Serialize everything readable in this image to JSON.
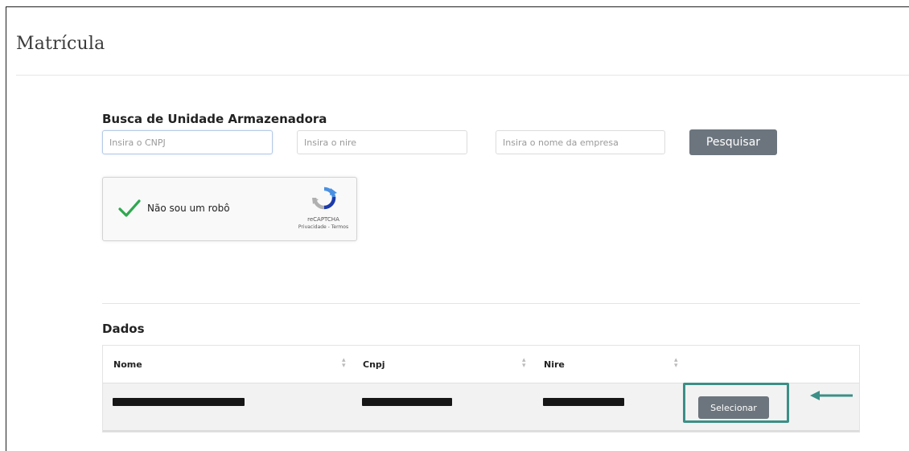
{
  "page": {
    "title": "Matrícula"
  },
  "search": {
    "heading": "Busca de Unidade Armazenadora",
    "cnpj_placeholder": "Insira o CNPJ",
    "nire_placeholder": "Insira o nire",
    "company_placeholder": "Insira o nome da empresa",
    "search_button": "Pesquisar"
  },
  "captcha": {
    "label": "Não sou um robô",
    "brand": "reCAPTCHA",
    "links": "Privacidade - Termos",
    "checked": true
  },
  "results": {
    "heading": "Dados",
    "columns": [
      "Nome",
      "Cnpj",
      "Nire",
      ""
    ],
    "rows": [
      {
        "nome": "",
        "cnpj": "",
        "nire": "",
        "action": "Selecionar"
      }
    ]
  },
  "colors": {
    "button_gray": "#6c757d",
    "highlight_teal": "#3b8f86",
    "check_green": "#2fa84f"
  },
  "icons": {
    "check": "check-icon",
    "recaptcha": "recaptcha-logo-icon",
    "sort": "sort-icon",
    "arrow": "arrow-left-icon"
  }
}
